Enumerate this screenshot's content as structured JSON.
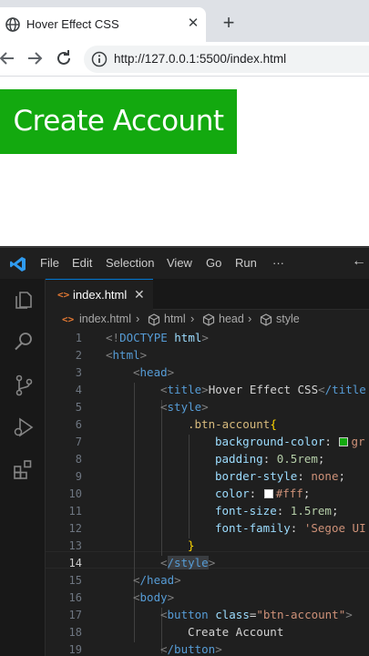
{
  "browser": {
    "tab_title": "Hover Effect CSS",
    "tab_close": "✕",
    "new_tab": "+",
    "url": "http://127.0.0.1:5500/index.html"
  },
  "page": {
    "button_label": "Create Account",
    "button_color": "#13a90f"
  },
  "vscode": {
    "menu": [
      "File",
      "Edit",
      "Selection",
      "View",
      "Go",
      "Run",
      "···"
    ],
    "editor_tab": {
      "label": "index.html",
      "close": "✕",
      "glyph": "<>"
    },
    "breadcrumb": [
      "index.html",
      "html",
      "head",
      "style"
    ],
    "active_line": 14,
    "line_numbers": [
      "1",
      "2",
      "3",
      "4",
      "5",
      "6",
      "7",
      "8",
      "9",
      "10",
      "11",
      "12",
      "13",
      "14",
      "15",
      "16",
      "17",
      "18",
      "19"
    ],
    "code": {
      "l1_a": "<!",
      "l1_b": "DOCTYPE",
      "l1_c": " html",
      "l1_d": ">",
      "l2_tag": "html",
      "l3_tag": "head",
      "l4_open": "title",
      "l4_text": "Hover Effect CSS",
      "l4_close": "/title",
      "l5_tag": "style",
      "l6_sel": ".btn-account",
      "l6_brace": "{",
      "l7_prop": "background-color",
      "l7_val": "gr",
      "l8_prop": "padding",
      "l8_val": "0.5rem",
      "l9_prop": "border-style",
      "l9_val": "none",
      "l10_prop": "color",
      "l10_val": "#fff",
      "l11_prop": "font-size",
      "l11_val": "1.5rem",
      "l12_prop": "font-family",
      "l12_val": "'Segoe UI",
      "l13_brace": "}",
      "l14_tag": "/style",
      "l15_tag": "/head",
      "l16_tag": "body",
      "l17_tag": "button",
      "l17_attr": "class",
      "l17_val": "\"btn-account\"",
      "l18_text": "Create Account",
      "l19_tag": "/button"
    }
  },
  "colors": {
    "swatch_green": "#13a90f",
    "swatch_white": "#ffffff"
  }
}
